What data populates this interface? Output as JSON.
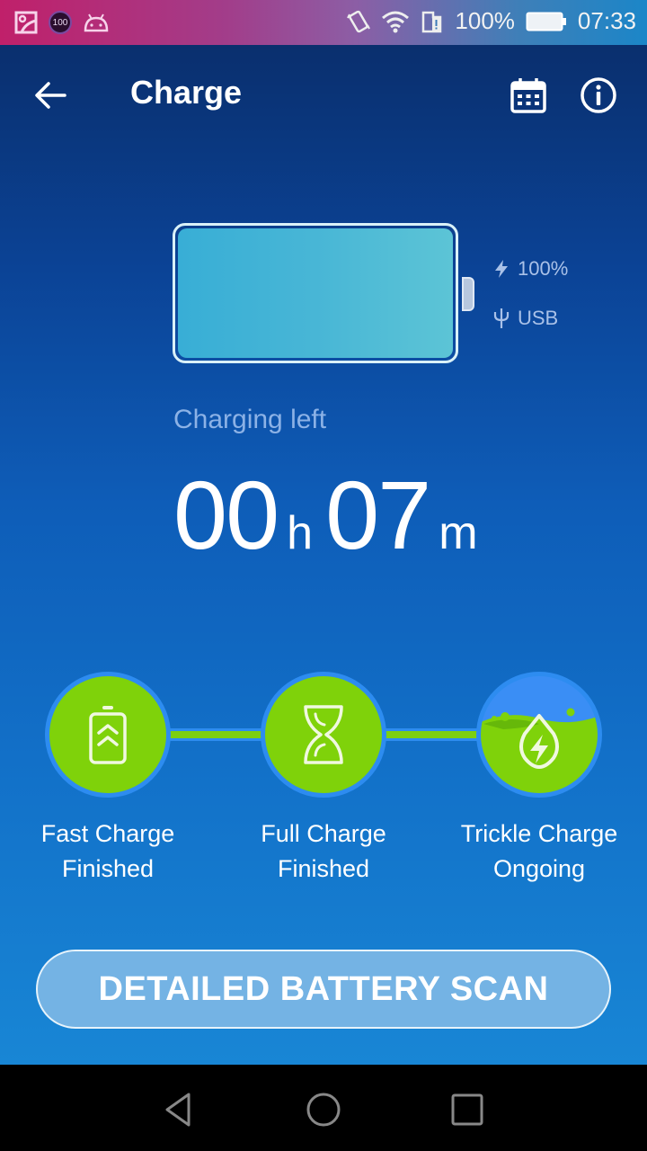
{
  "status_bar": {
    "notification_badge": "100",
    "battery_percent": "100%",
    "time": "07:33"
  },
  "app_bar": {
    "title": "Charge"
  },
  "battery": {
    "level_percent": 100,
    "charge_level_text": "100%",
    "source_text": "USB"
  },
  "charging": {
    "label": "Charging left",
    "hours": "00",
    "hours_unit": "h",
    "minutes": "07",
    "minutes_unit": "m"
  },
  "steps": [
    {
      "title": "Fast Charge",
      "status": "Finished",
      "icon": "battery-up-icon"
    },
    {
      "title": "Full Charge",
      "status": "Finished",
      "icon": "hourglass-icon"
    },
    {
      "title": "Trickle Charge",
      "status": "Ongoing",
      "icon": "drop-bolt-icon"
    }
  ],
  "scan_button": {
    "label": "DETAILED BATTERY SCAN"
  },
  "colors": {
    "accent_green": "#7fd20a",
    "step_border_blue": "#2d8cf0",
    "header_navy": "#0a2f6e"
  }
}
